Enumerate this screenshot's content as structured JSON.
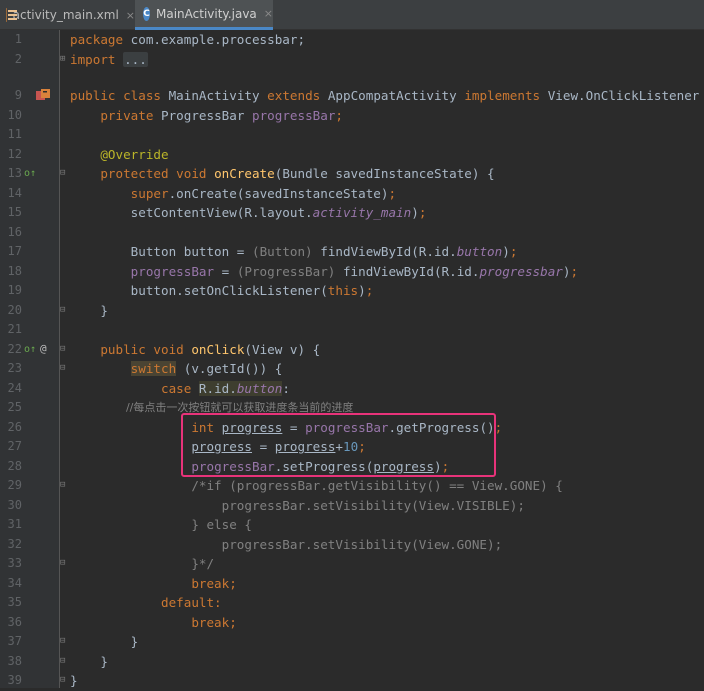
{
  "tabs": [
    {
      "label": "activity_main.xml",
      "icon": "xml-file-icon",
      "active": false,
      "close": "×"
    },
    {
      "label": "MainActivity.java",
      "icon": "java-class-icon",
      "active": true,
      "close": "×"
    }
  ],
  "lines": {
    "l1": {
      "num": "1",
      "a": "package",
      "b": " com.example.processbar;"
    },
    "l2": {
      "num": "2",
      "a": "import",
      "dots": "..."
    },
    "l9": {
      "num": "9",
      "a": "public class ",
      "b": "MainActivity ",
      "c": "extends ",
      "d": "AppCompatActivity ",
      "e": "implements ",
      "f": "View.OnClickListener {"
    },
    "l10": {
      "num": "10",
      "a": "    private ",
      "b": "ProgressBar ",
      "c": "progressBar",
      "d": ";"
    },
    "l11": {
      "num": "11"
    },
    "l12": {
      "num": "12",
      "a": "    @Override"
    },
    "l13": {
      "num": "13",
      "a": "    protected void ",
      "b": "onCreate",
      "c": "(Bundle savedInstanceState) {"
    },
    "l14": {
      "num": "14",
      "a": "        super",
      "b": ".onCreate(savedInstanceState)",
      "c": ";"
    },
    "l15": {
      "num": "15",
      "a": "        setContentView(R.layout.",
      "b": "activity_main",
      "c": ")",
      "d": ";"
    },
    "l16": {
      "num": "16"
    },
    "l17": {
      "num": "17",
      "a": "        Button button = ",
      "b": "(Button) ",
      "c": "findViewById(R.id.",
      "d": "button",
      "e": ")",
      "f": ";"
    },
    "l18": {
      "num": "18",
      "a": "        progressBar",
      "b": " = ",
      "c": "(ProgressBar) ",
      "d": "findViewById(R.id.",
      "e": "progressbar",
      "f": ")",
      "g": ";"
    },
    "l19": {
      "num": "19",
      "a": "        button.setOnClickListener(",
      "b": "this",
      "c": ")",
      "d": ";"
    },
    "l20": {
      "num": "20",
      "a": "    }"
    },
    "l21": {
      "num": "21"
    },
    "l22": {
      "num": "22",
      "a": "    public void ",
      "b": "onClick",
      "c": "(View v) {"
    },
    "l23": {
      "num": "23",
      "a": "        ",
      "b": "switch",
      "c": " (v.getId()) {"
    },
    "l24": {
      "num": "24",
      "a": "            case ",
      "b": "R.id.",
      "c": "button",
      "d": ":"
    },
    "l25": {
      "num": "25",
      "a": "                //每点击一次按钮就可以获取进度条当前的进度"
    },
    "l26": {
      "num": "26",
      "a": "                int ",
      "b": "progress",
      "c": " = ",
      "d": "progressBar",
      "e": ".getProgress()",
      "f": ";"
    },
    "l27": {
      "num": "27",
      "a": "                ",
      "b": "progress",
      "c": " = ",
      "d": "progress",
      "e": "+",
      "f": "10",
      "g": ";"
    },
    "l28": {
      "num": "28",
      "a": "                ",
      "b": "progressBar",
      "c": ".setProgress(",
      "d": "progress",
      "e": ")",
      "f": ";"
    },
    "l29": {
      "num": "29",
      "a": "                /*if (progressBar.getVisibility() == View.GONE) {"
    },
    "l30": {
      "num": "30",
      "a": "                    progressBar.setVisibility(View.VISIBLE);"
    },
    "l31": {
      "num": "31",
      "a": "                } else {"
    },
    "l32": {
      "num": "32",
      "a": "                    progressBar.setVisibility(View.GONE);"
    },
    "l33": {
      "num": "33",
      "a": "                }*/"
    },
    "l34": {
      "num": "34",
      "a": "                break;"
    },
    "l35": {
      "num": "35",
      "a": "            default:"
    },
    "l36": {
      "num": "36",
      "a": "                break;"
    },
    "l37": {
      "num": "37",
      "a": "        }"
    },
    "l38": {
      "num": "38",
      "a": "    }"
    },
    "l39": {
      "num": "39",
      "a": "}"
    }
  },
  "gutter_icons": {
    "l9": "class-file-icon",
    "l13": "override-icon",
    "l22": "implements-override-icon",
    "l22b": "annotation-at-icon"
  },
  "highlight_box_color": "#e8337a"
}
